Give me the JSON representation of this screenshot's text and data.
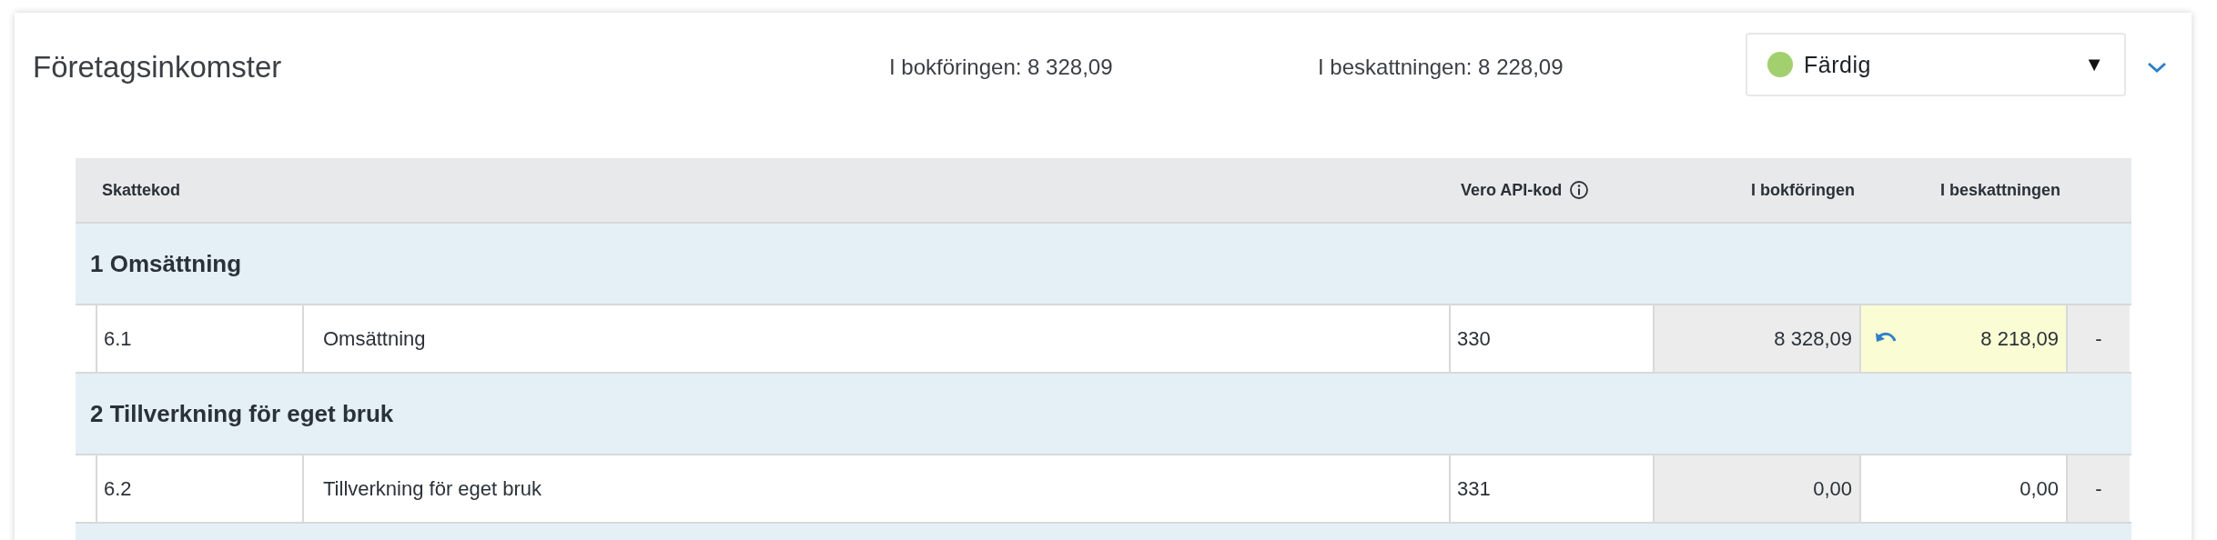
{
  "section": {
    "title": "Företagsinkomster",
    "bookkeeping_total": "I bokföringen: 8 328,09",
    "taxation_total": "I beskattningen: 8 228,09",
    "status": {
      "value": "Färdig",
      "color": "#a3d06f",
      "caret": "▼"
    },
    "expanded": true
  },
  "table": {
    "columns": [
      "Skattekod",
      "Vero API-kod",
      "I bokföringen",
      "I beskattningen"
    ],
    "groups": [
      {
        "title": "1 Omsättning",
        "rows": [
          {
            "code": "6.1",
            "name": "Omsättning",
            "api_code": "330",
            "bookkeeping": "8 328,09",
            "taxation": "8 218,09",
            "modified": true,
            "extra": "-"
          }
        ]
      },
      {
        "title": "2 Tillverkning för eget bruk",
        "rows": [
          {
            "code": "6.2",
            "name": "Tillverkning för eget bruk",
            "api_code": "331",
            "bookkeeping": "0,00",
            "taxation": "0,00",
            "modified": false,
            "extra": "-"
          }
        ]
      }
    ],
    "more_below": true
  }
}
